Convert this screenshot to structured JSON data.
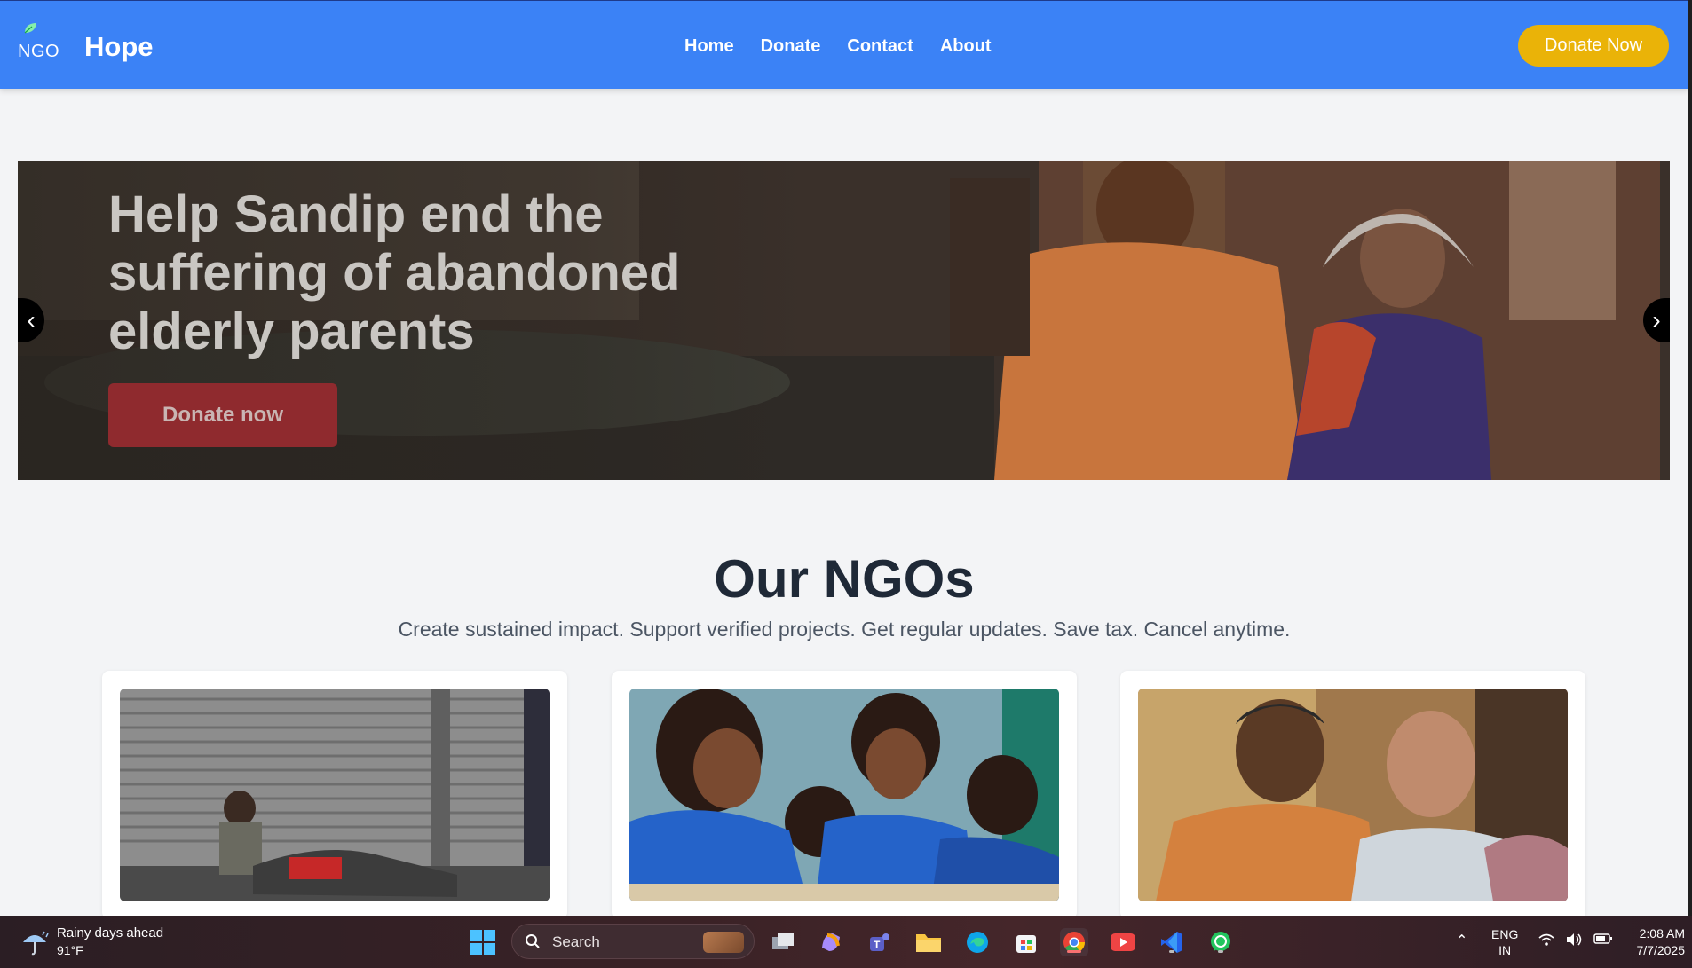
{
  "header": {
    "logo_text": "NGO",
    "brand": "Hope",
    "nav": [
      "Home",
      "Donate",
      "Contact",
      "About"
    ],
    "cta": "Donate Now"
  },
  "hero": {
    "title": "Help Sandip end the suffering of abandoned elderly parents",
    "button": "Donate now",
    "prev": "‹",
    "next": "›"
  },
  "section": {
    "title": "Our NGOs",
    "subtitle": "Create sustained impact. Support verified projects. Get regular updates. Save tax. Cancel anytime."
  },
  "taskbar": {
    "weather_title": "Rainy days ahead",
    "weather_temp": "91°F",
    "search": "Search",
    "lang_top": "ENG",
    "lang_bottom": "IN",
    "time": "2:08 AM",
    "date": "7/7/2025"
  },
  "colors": {
    "header": "#3b82f6",
    "cta": "#eab308",
    "hero_button": "#8f2a2e"
  }
}
